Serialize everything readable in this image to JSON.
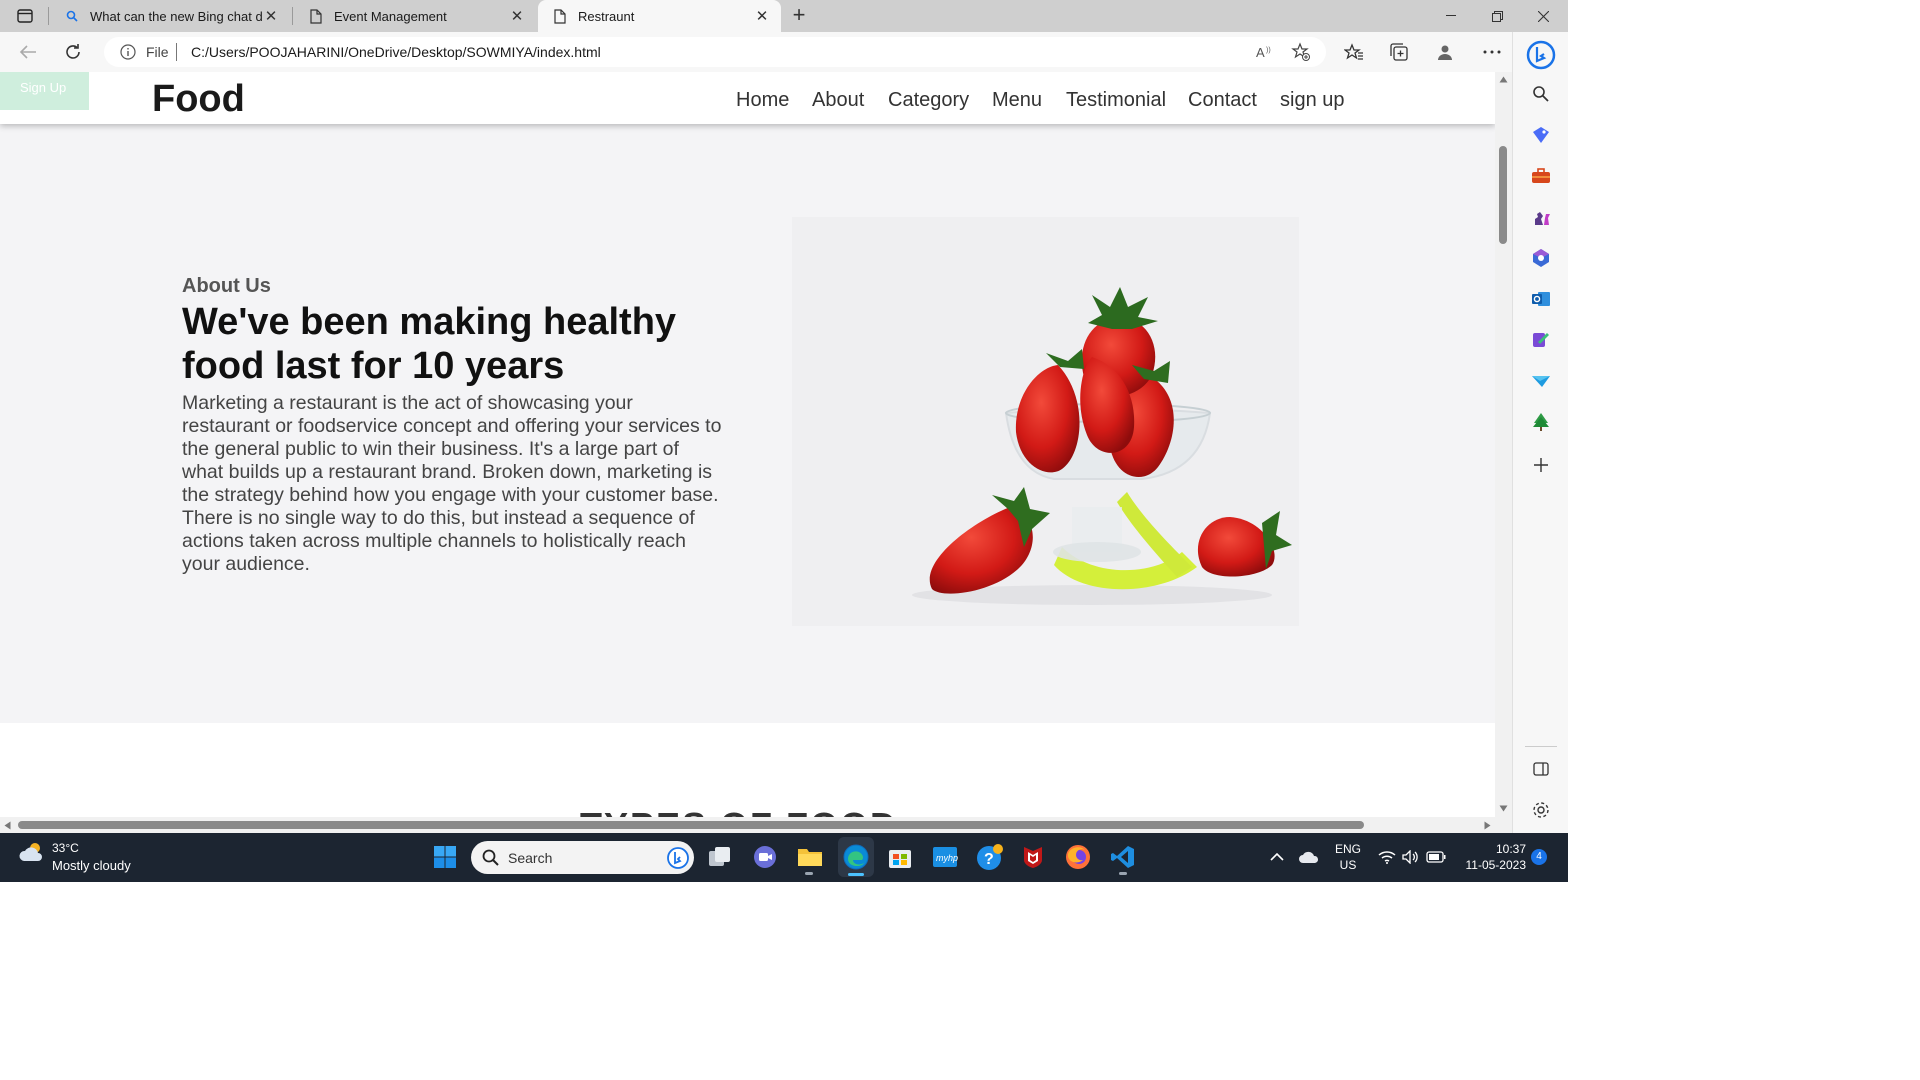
{
  "browser": {
    "tabs": [
      {
        "title": "What can the new Bing chat do?",
        "icon": "bing-search-icon",
        "active": false
      },
      {
        "title": "Event Management",
        "icon": "page-icon",
        "active": false
      },
      {
        "title": "Restraunt",
        "icon": "page-icon",
        "active": true
      }
    ],
    "address": {
      "scheme_label": "File",
      "url": "C:/Users/POOJAHARINI/OneDrive/Desktop/SOWMIYA/index.html"
    }
  },
  "site": {
    "signup_badge": "Sign Up",
    "brand": "Food",
    "nav": [
      "Home",
      "About",
      "Category",
      "Menu",
      "Testimonial",
      "Contact",
      "sign up"
    ],
    "about": {
      "eyebrow": "About Us",
      "heading": "We've been making healthy food last for 10 years",
      "body": "Marketing a restaurant is the act of showcasing your restaurant or foodservice concept and offering your services to the general public to win their business. It's a large part of what builds up a restaurant brand. Broken down, marketing is the strategy behind how you engage with your customer base. There is no single way to do this, but instead a sequence of actions taken across multiple channels to holistically reach your audience."
    },
    "next_section_title": "TYPES OF FOOD"
  },
  "taskbar": {
    "weather": {
      "temp": "33°C",
      "condition": "Mostly cloudy"
    },
    "search_placeholder": "Search",
    "language": [
      "ENG",
      "US"
    ],
    "time": "10:37",
    "date": "11-05-2023",
    "notification_count": "4"
  },
  "colors": {
    "accent_bing": "#1a73e8",
    "signup_badge": "#cfeedd",
    "taskbar": "#1c2531"
  }
}
